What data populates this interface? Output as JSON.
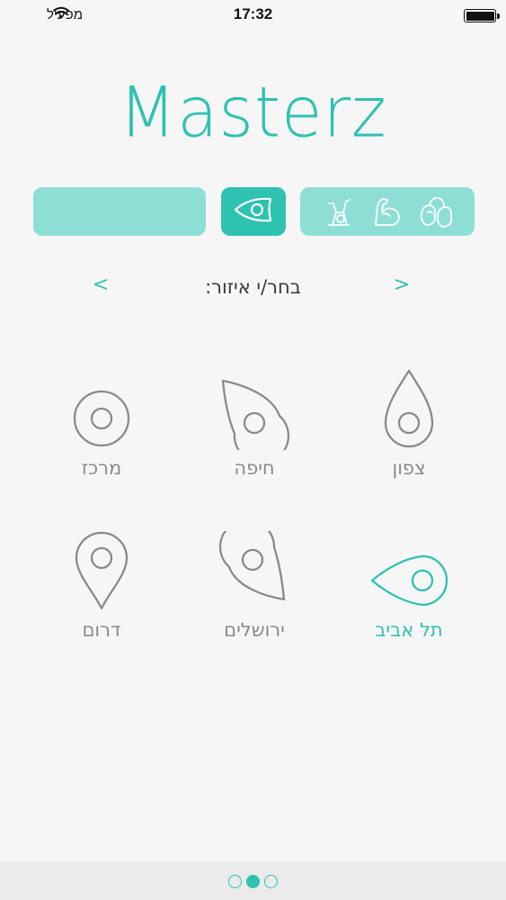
{
  "status_bar": {
    "carrier": "מפעיל",
    "time": "17:32"
  },
  "app": {
    "logo": "Masterz",
    "accent_color": "#2ec2b1",
    "accent_light": "#8ddfd6"
  },
  "filters": {
    "location_icon": "location-eye-pin-icon",
    "categories": [
      {
        "icon": "exercise-bike-icon"
      },
      {
        "icon": "flexed-arm-icon"
      },
      {
        "icon": "boxing-gloves-icon"
      }
    ]
  },
  "region_nav": {
    "prev": "<",
    "next": ">",
    "title": "בחר/י איזור:"
  },
  "regions": [
    {
      "label": "צפון",
      "icon": "pin-up-icon",
      "active": false
    },
    {
      "label": "חיפה",
      "icon": "pin-tilted-up-left-icon",
      "active": false
    },
    {
      "label": "מרכז",
      "icon": "pin-circle-icon",
      "active": false
    },
    {
      "label": "תל אביב",
      "icon": "pin-left-icon",
      "active": true
    },
    {
      "label": "ירושלים",
      "icon": "pin-tilted-down-right-icon",
      "active": false
    },
    {
      "label": "דרום",
      "icon": "pin-down-icon",
      "active": false
    }
  ],
  "pager": {
    "pages": 3,
    "current": 2
  }
}
